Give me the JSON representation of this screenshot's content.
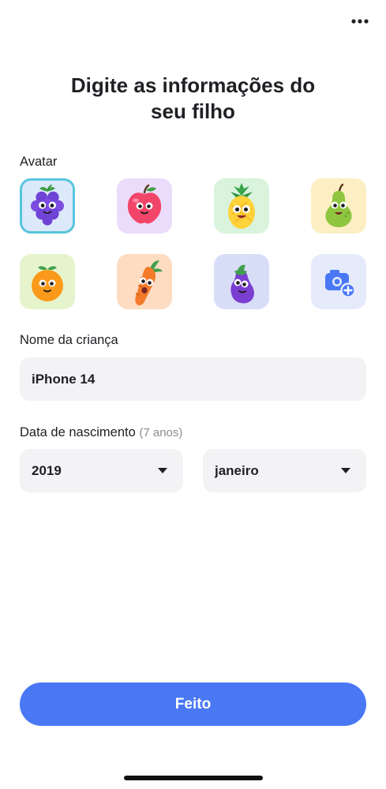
{
  "header": {
    "title_line1": "Digite as informações do",
    "title_line2": "seu filho",
    "more_icon": "more-horizontal-icon"
  },
  "avatar_section": {
    "label": "Avatar",
    "items": [
      {
        "name": "grape",
        "bg": "#dbe9fb",
        "selected": true
      },
      {
        "name": "apple",
        "bg": "#ecdcfb",
        "selected": false
      },
      {
        "name": "pineapple",
        "bg": "#d9f3dd",
        "selected": false
      },
      {
        "name": "pear",
        "bg": "#fdefc4",
        "selected": false
      },
      {
        "name": "orange",
        "bg": "#e5f4cc",
        "selected": false
      },
      {
        "name": "carrot",
        "bg": "#fddcc2",
        "selected": false
      },
      {
        "name": "eggplant",
        "bg": "#d8def8",
        "selected": false
      },
      {
        "name": "camera-add",
        "bg": "#e5ebfb",
        "selected": false
      }
    ]
  },
  "name_section": {
    "label": "Nome da criança",
    "value": "iPhone 14"
  },
  "birth_section": {
    "label": "Data de nascimento",
    "age_note": "(7 anos)",
    "year": "2019",
    "month": "janeiro"
  },
  "footer": {
    "done_label": "Feito"
  },
  "colors": {
    "accent": "#4a78f5",
    "selected_border": "#57c6dc",
    "field_bg": "#f3f3f5"
  }
}
